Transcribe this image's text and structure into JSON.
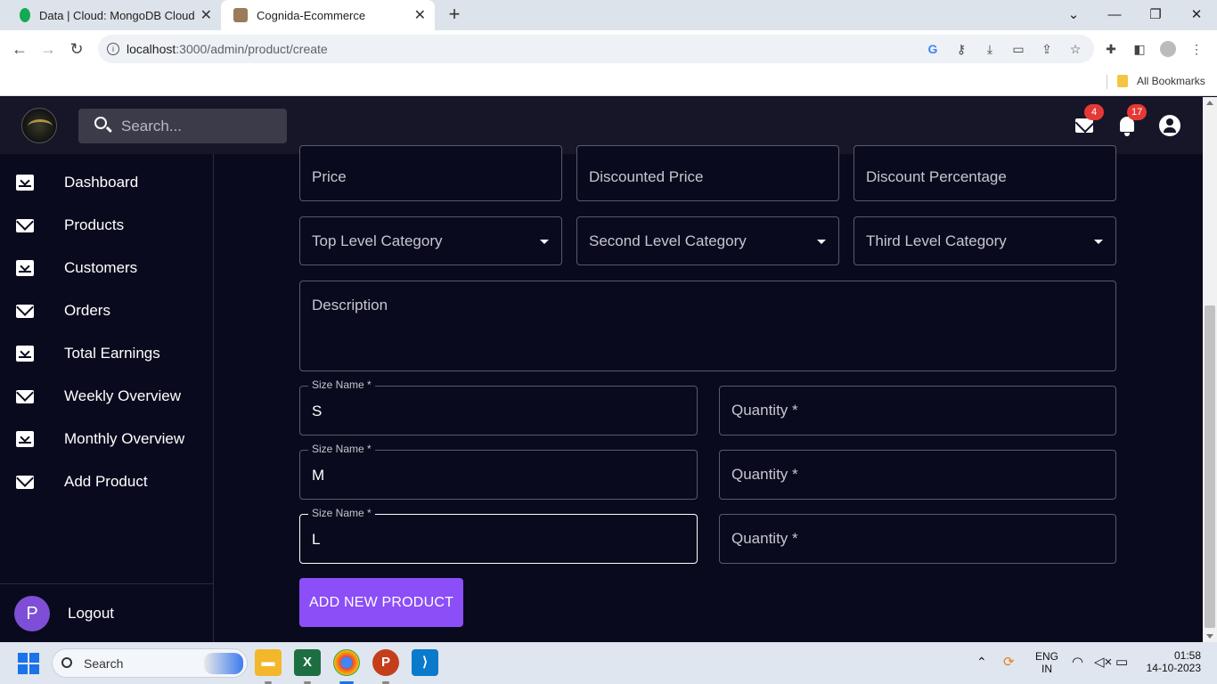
{
  "browser": {
    "tabs": [
      {
        "title": "Data | Cloud: MongoDB Cloud",
        "icon": "mongodb-leaf-icon",
        "color": "#13aa52"
      },
      {
        "title": "Cognida-Ecommerce",
        "icon": "site-favicon-icon",
        "color": "#9a7b5a"
      }
    ],
    "url_host": "localhost",
    "url_path": ":3000/admin/product/create",
    "bookmarks_label": "All Bookmarks"
  },
  "app": {
    "search_placeholder": "Search...",
    "mail_count": "4",
    "notification_count": "17",
    "sidebar": [
      {
        "label": "Dashboard",
        "icon": "inbox-icon"
      },
      {
        "label": "Products",
        "icon": "mail-icon"
      },
      {
        "label": "Customers",
        "icon": "inbox-icon"
      },
      {
        "label": "Orders",
        "icon": "mail-icon"
      },
      {
        "label": "Total Earnings",
        "icon": "inbox-icon"
      },
      {
        "label": "Weekly Overview",
        "icon": "mail-icon"
      },
      {
        "label": "Monthly Overview",
        "icon": "inbox-icon"
      },
      {
        "label": "Add Product",
        "icon": "mail-icon"
      }
    ],
    "avatar_letter": "P",
    "logout_label": "Logout",
    "form": {
      "price_placeholder": "Price",
      "discounted_price_placeholder": "Discounted Price",
      "discount_percentage_placeholder": "Discount Percentage",
      "top_category_placeholder": "Top Level Category",
      "second_category_placeholder": "Second Level Category",
      "third_category_placeholder": "Third Level Category",
      "description_placeholder": "Description",
      "size_label": "Size Name *",
      "quantity_placeholder": "Quantity *",
      "sizes": [
        {
          "name": "S"
        },
        {
          "name": "M"
        },
        {
          "name": "L"
        }
      ],
      "submit_label": "ADD NEW PRODUCT"
    },
    "accent_color": "#8b4ef7"
  },
  "taskbar": {
    "search_label": "Search",
    "lang_top": "ENG",
    "lang_bottom": "IN",
    "time": "01:58",
    "date": "14-10-2023"
  }
}
